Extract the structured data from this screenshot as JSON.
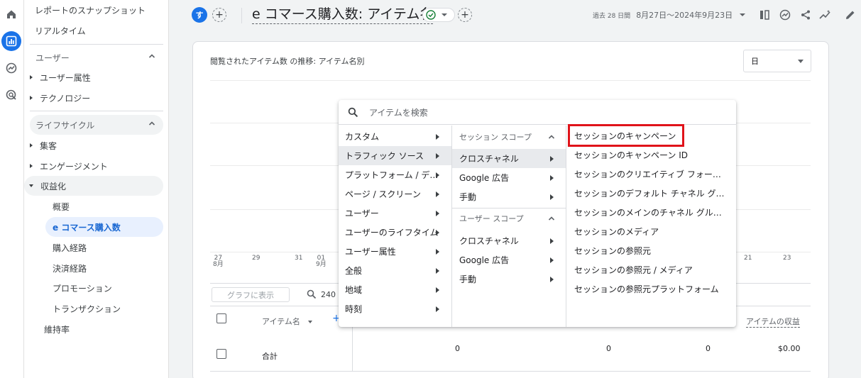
{
  "sidebar": {
    "top_items": [
      "レポートのスナップショット",
      "リアルタイム"
    ],
    "sections": [
      {
        "label": "ユーザー",
        "items": [
          "ユーザー属性",
          "テクノロジー"
        ]
      },
      {
        "label": "ライフサイクル",
        "items": [
          "集客",
          "エンゲージメント",
          "収益化"
        ]
      }
    ],
    "monetization_sub": [
      "概要",
      "e コマース購入数",
      "購入経路",
      "決済経路",
      "プロモーション",
      "トランザクション"
    ],
    "retention": "維持率"
  },
  "header": {
    "avatar_letter": "す",
    "title": "e コマース購入数: アイテム名",
    "date_prefix": "過去 28 日間",
    "date_range": "8月27日～2024年9月23日"
  },
  "card": {
    "chart_title": "閲覧されたアイテム数 の推移: アイテム名別",
    "granularity": "日",
    "x_ticks": [
      {
        "day": "27",
        "month": "8月"
      },
      {
        "day": "29",
        "month": ""
      },
      {
        "day": "31",
        "month": ""
      },
      {
        "day": "01",
        "month": "9月"
      },
      {
        "day": "21",
        "month": ""
      },
      {
        "day": "23",
        "month": ""
      }
    ],
    "plot_button": "グラフに表示",
    "search_value": "240",
    "col_item": "アイテム名",
    "col_revenue": "アイテムの収益",
    "total_label": "合計",
    "total_values": [
      "0",
      "0",
      "0",
      "$0.00"
    ]
  },
  "menu": {
    "search_placeholder": "アイテムを検索",
    "col1": [
      "カスタム",
      "トラフィック ソース",
      "プラットフォーム / デバイス",
      "ページ / スクリーン",
      "ユーザー",
      "ユーザーのライフタイム",
      "ユーザー属性",
      "全般",
      "地域",
      "時刻"
    ],
    "col2_scope1": "セッション スコープ",
    "col2_group1": [
      "クロスチャネル",
      "Google 広告",
      "手動"
    ],
    "col2_scope2": "ユーザー スコープ",
    "col2_group2": [
      "クロスチャネル",
      "Google 広告",
      "手動"
    ],
    "col3": [
      "セッションのキャンペーン",
      "セッションのキャンペーン ID",
      "セッションのクリエイティブ フォーマット",
      "セッションのデフォルト チャネル グループ",
      "セッションのメインのチャネル グループ",
      "セッションのメディア",
      "セッションの参照元",
      "セッションの参照元 / メディア",
      "セッションの参照元プラットフォーム"
    ]
  },
  "colors": {
    "accent": "#1a73e8",
    "highlight": "#e0131a"
  }
}
